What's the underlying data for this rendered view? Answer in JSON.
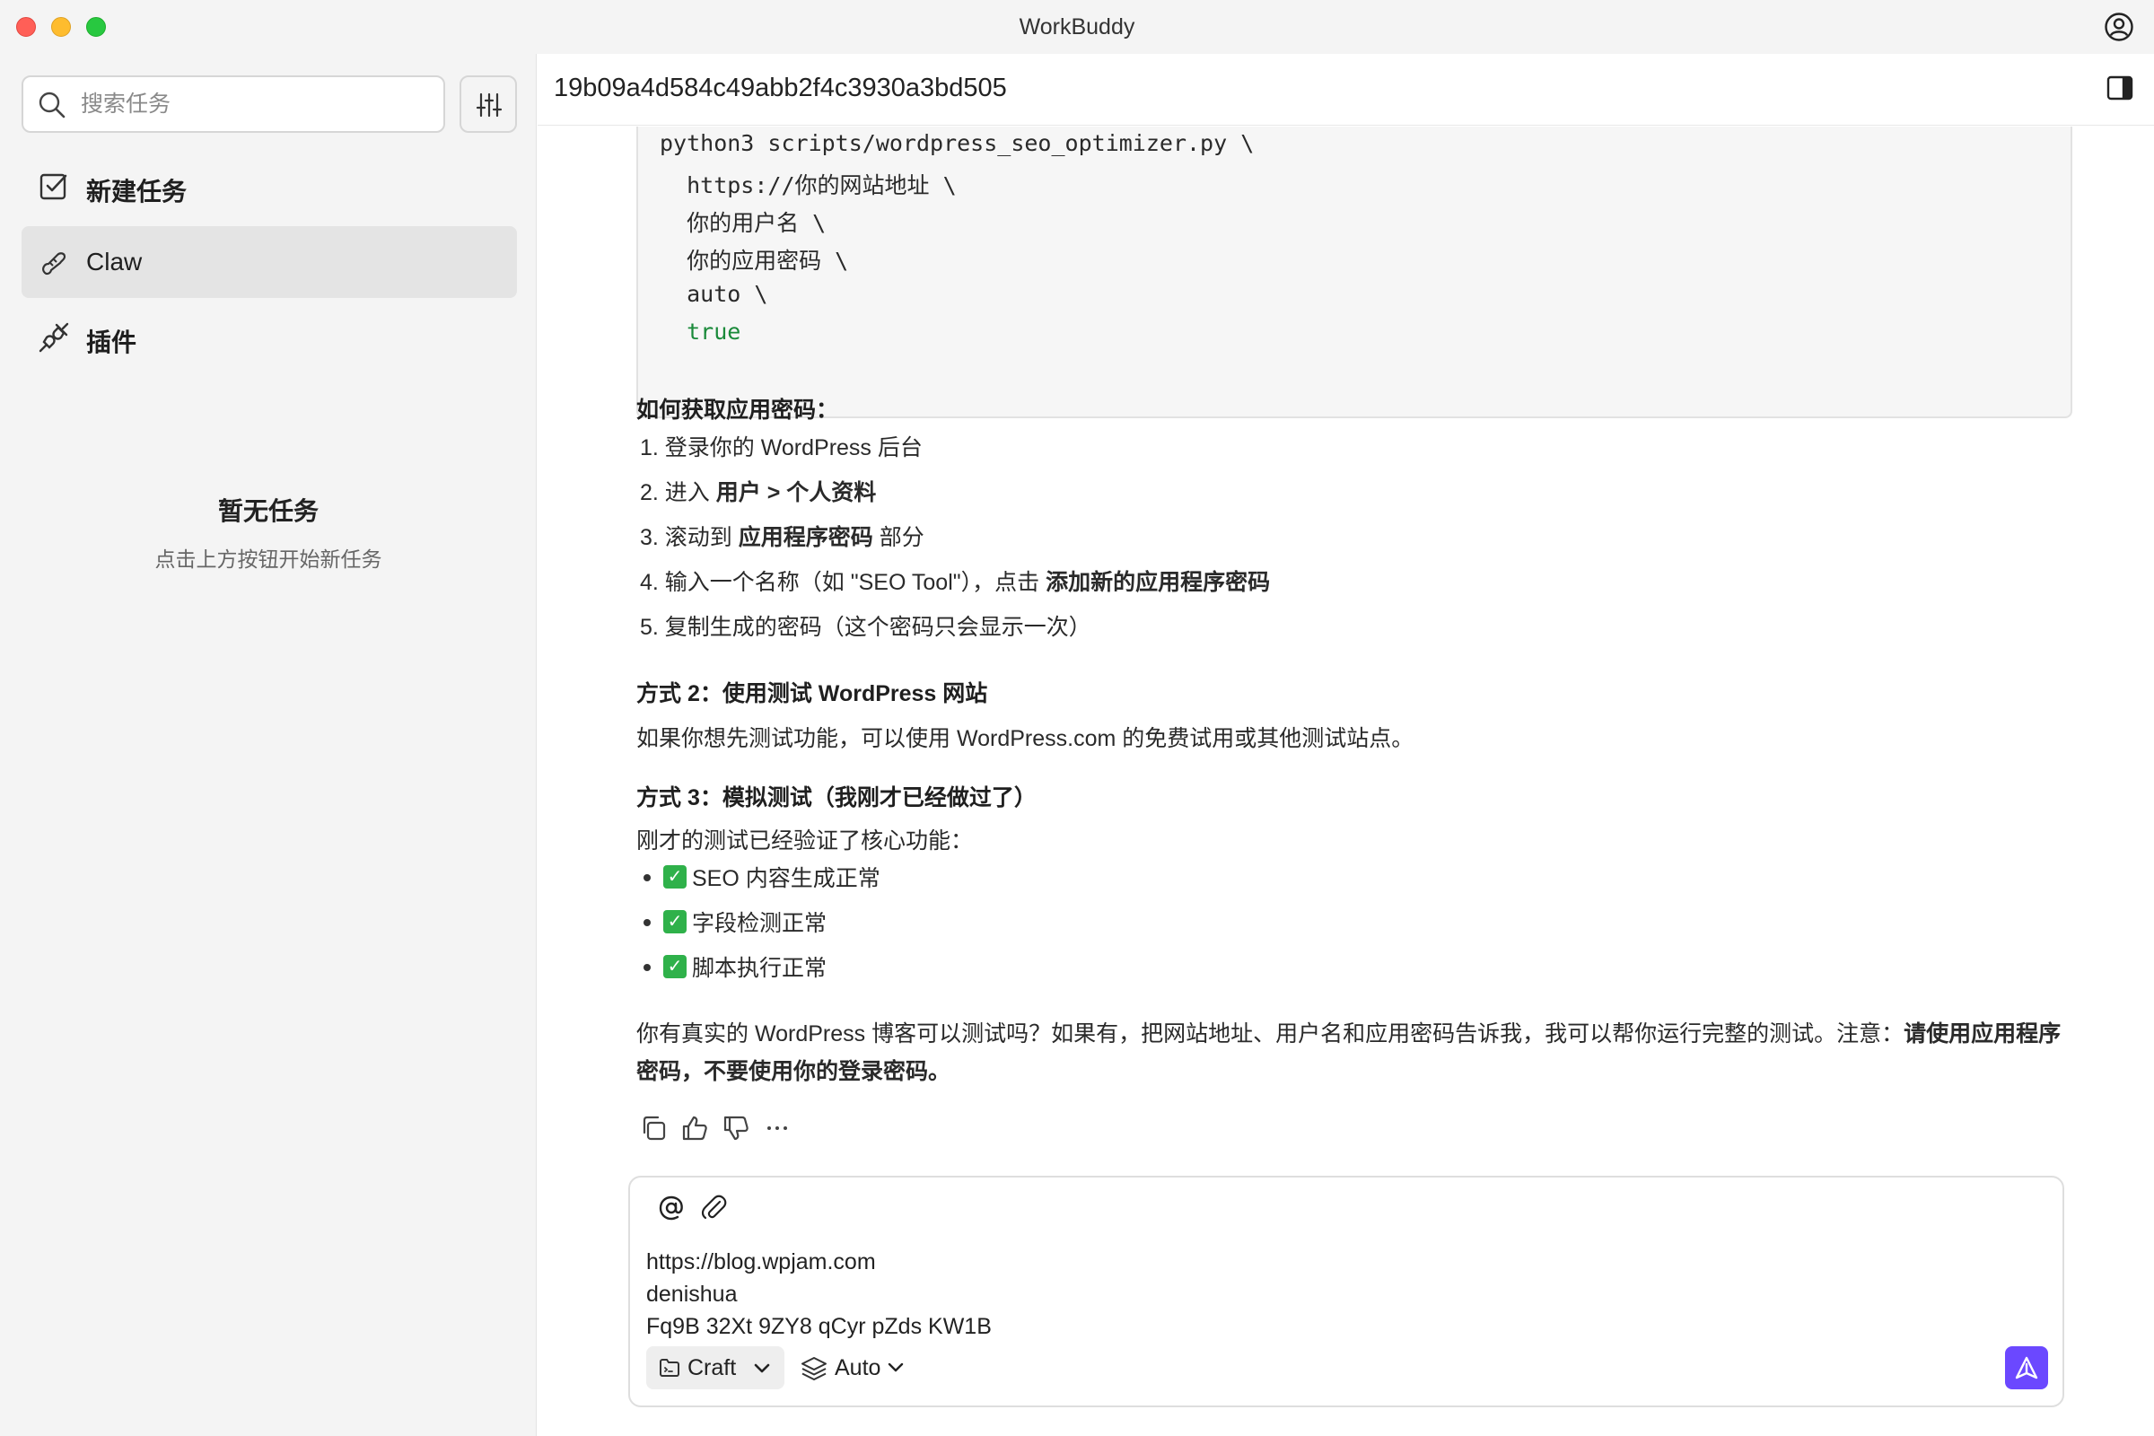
{
  "window": {
    "title": "WorkBuddy"
  },
  "sidebar": {
    "search_placeholder": "搜索任务",
    "nav": [
      {
        "label": "新建任务",
        "icon": "new-task-icon"
      },
      {
        "label": "Claw",
        "icon": "claw-icon",
        "active": true
      },
      {
        "label": "插件",
        "icon": "plugin-icon"
      }
    ],
    "empty": {
      "title": "暂无任务",
      "subtitle": "点击上方按钮开始新任务"
    }
  },
  "main": {
    "task_id": "19b09a4d584c49abb2f4c3930a3bd505",
    "code_lines": [
      "python3 scripts/wordpress_seo_optimizer.py \\",
      "  https://你的网站地址 \\",
      "  你的用户名 \\",
      "  你的应用密码 \\",
      "  auto \\",
      "  true"
    ],
    "howto_heading": "如何获取应用密码：",
    "steps": [
      {
        "num": "1. ",
        "text": "登录你的 WordPress 后台",
        "bold": "",
        "after": ""
      },
      {
        "num": "2. ",
        "text": "进入 ",
        "bold": "用户 > 个人资料",
        "after": ""
      },
      {
        "num": "3. ",
        "text": "滚动到 ",
        "bold": "应用程序密码",
        "after": " 部分"
      },
      {
        "num": "4. ",
        "text": "输入一个名称（如 \"SEO Tool\"），点击 ",
        "bold": "添加新的应用程序密码",
        "after": ""
      },
      {
        "num": "5. ",
        "text": "复制生成的密码（这个密码只会显示一次）",
        "bold": "",
        "after": ""
      }
    ],
    "method2_heading": "方式 2：使用测试 WordPress 网站",
    "method2_text": "如果你想先测试功能，可以使用 WordPress.com 的免费试用或其他测试站点。",
    "method3_heading": "方式 3：模拟测试（我刚才已经做过了）",
    "method3_intro": "刚才的测试已经验证了核心功能：",
    "checks": [
      "SEO 内容生成正常",
      "字段检测正常",
      "脚本执行正常"
    ],
    "final_text": "你有真实的 WordPress 博客可以测试吗？如果有，把网站地址、用户名和应用密码告诉我，我可以帮你运行完整的测试。注意：",
    "final_bold": "请使用应用程序密码，不要使用你的登录密码。",
    "actions": [
      "copy-icon",
      "thumbs-up-icon",
      "thumbs-down-icon",
      "more-icon"
    ]
  },
  "composer": {
    "lines": [
      "https://blog.wpjam.com",
      "denishua",
      "Fq9B 32Xt 9ZY8 qCyr pZds KW1B"
    ],
    "mode_label": "Craft",
    "model_label": "Auto",
    "send_color": "#6b48ff"
  }
}
